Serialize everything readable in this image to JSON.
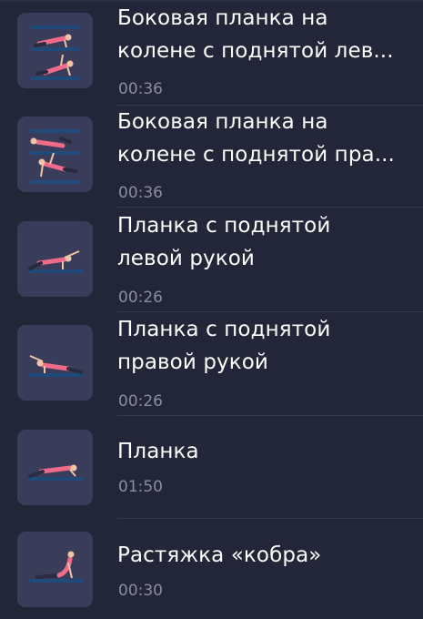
{
  "exercises": [
    {
      "title_line1": "Боковая планка на",
      "title_line2": "колене с поднятой лев...",
      "duration": "00:36",
      "icon": "side-plank-knee-left-icon"
    },
    {
      "title_line1": "Боковая планка на",
      "title_line2": "колене с поднятой пра...",
      "duration": "00:36",
      "icon": "side-plank-knee-right-icon"
    },
    {
      "title_line1": "Планка с поднятой",
      "title_line2": "левой рукой",
      "duration": "00:26",
      "icon": "plank-left-arm-icon"
    },
    {
      "title_line1": "Планка с поднятой",
      "title_line2": "правой рукой",
      "duration": "00:26",
      "icon": "plank-right-arm-icon"
    },
    {
      "title_line1": "Планка",
      "duration": "01:50",
      "icon": "plank-icon"
    },
    {
      "title_line1": "Растяжка «кобра»",
      "duration": "00:30",
      "icon": "cobra-stretch-icon"
    }
  ],
  "colors": {
    "background": "#232539",
    "thumb": "#3a3d5a",
    "text": "#ffffff",
    "duration_text": "#8a8ca1",
    "mat": "#1f4a7a",
    "figure_pink": "#f06b8a"
  }
}
